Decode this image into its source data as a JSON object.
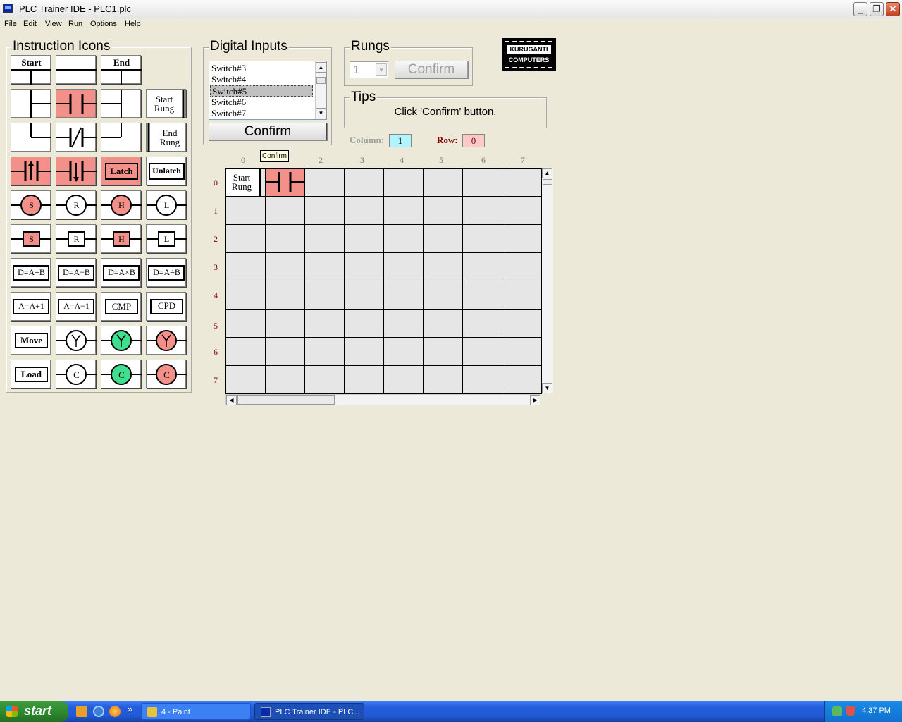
{
  "window": {
    "title": "PLC Trainer IDE - PLC1.plc",
    "minimize": "_",
    "maximize": "❐",
    "close": "✕"
  },
  "menu": [
    "File",
    "Edit",
    "View",
    "Run",
    "Options",
    "Help"
  ],
  "instruction_icons": {
    "title": "Instruction Icons",
    "labels": {
      "start": "Start",
      "end": "End",
      "start_rung": "Start Rung",
      "end_rung": "End Rung",
      "latch": "Latch",
      "unlatch": "Unlatch",
      "s": "S",
      "r": "R",
      "h": "H",
      "l": "L",
      "add": "D=A+B",
      "sub": "D=A−B",
      "mul": "D=A×B",
      "div": "D=A÷B",
      "inc": "A=A+1",
      "dec": "A=A−1",
      "cmp": "CMP",
      "cpd": "CPD",
      "move": "Move",
      "load": "Load",
      "c": "C"
    }
  },
  "digital_inputs": {
    "title": "Digital Inputs",
    "items": [
      "Switch#3",
      "Switch#4",
      "Switch#5",
      "Switch#6",
      "Switch#7"
    ],
    "selected": "Switch#5",
    "confirm": "Confirm"
  },
  "rungs": {
    "title": "Rungs",
    "value": "1",
    "confirm": "Confirm"
  },
  "logo": {
    "line1": "KURUGANTI",
    "line2": "COMPUTERS"
  },
  "tips": {
    "title": "Tips",
    "text": "Click 'Confirm' button."
  },
  "position": {
    "column_label": "Column:",
    "column": "1",
    "row_label": "Row:",
    "row": "0"
  },
  "tooltip": "Confirm",
  "grid": {
    "columns": [
      "0",
      "1",
      "2",
      "3",
      "4",
      "5",
      "6",
      "7"
    ],
    "rows": [
      "0",
      "1",
      "2",
      "3",
      "4",
      "5",
      "6",
      "7"
    ],
    "cell_00": "Start Rung"
  },
  "taskbar": {
    "start": "start",
    "tasks": [
      "4 - Paint",
      "PLC Trainer IDE - PLC..."
    ],
    "time": "4:37 PM"
  },
  "colors": {
    "highlight": "#f4908a",
    "green": "#3fdf8f",
    "accent": "#800000"
  }
}
